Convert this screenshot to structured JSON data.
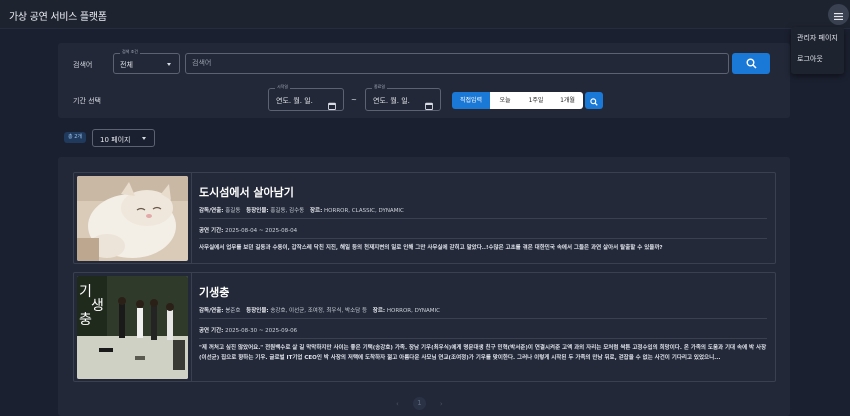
{
  "app": {
    "title": "가상 공연 서비스 플랫폼"
  },
  "menu": {
    "items": [
      "관리자 페이지",
      "로그아웃"
    ]
  },
  "search": {
    "label": "검색어",
    "condition_legend": "검색 조건",
    "condition_value": "전체",
    "placeholder": "검색어"
  },
  "period": {
    "label": "기간 선택",
    "start_legend": "시작일",
    "start_value": "연도. 월. 일.",
    "tilde": "~",
    "end_legend": "종료일",
    "end_value": "연도. 월. 일.",
    "ranges": [
      "직접입력",
      "오늘",
      "1주일",
      "1개월"
    ],
    "active_range": "직접입력"
  },
  "listing": {
    "total_badge": "총 2개",
    "page_size": "10 페이지"
  },
  "performances": [
    {
      "title": "도시섬에서 살아남기",
      "director_label": "감독/연출:",
      "director": "홍길동",
      "cast_label": "등장인물:",
      "cast": "홍길동, 김수동",
      "genre_label": "장르:",
      "genre": "HORROR, CLASSIC, DYNAMIC",
      "period_label": "공연 기간:",
      "period": "2025-08-04 ~ 2025-08-04",
      "description": "사무실에서 업무를 보던 길동과 수동이, 갑작스레 닥친 지진, 해일 등의 천재지변의 일로 인해 그만 사무실에 갇히고 말았다..!수많은 고초를 겪은 대한민국 속에서 그들은 과연 살아서 탈출할 수 있을까?"
    },
    {
      "title": "기생충",
      "director_label": "감독/연출:",
      "director": "봉준호",
      "cast_label": "등장인물:",
      "cast": "송강호, 이선균, 조여정, 최우식, 박소담 등",
      "genre_label": "장르:",
      "genre": "HORROR, DYNAMIC",
      "period_label": "공연 기간:",
      "period": "2025-08-30 ~ 2025-09-06",
      "description": "\"제 꺼처고 싶진 않았어요.\" 전원백수로 살 길 막막하지만 사이는 좋은 기택(송강호) 가족. 장남 기우(최우식)에게 명문대생 친구 민혁(박서준)이 연결시켜준 고액 과외 자리는 모처럼 싹튼 고정수입의 희망이다. 온 가족의 도움과 기대 속에 박 사장(이선균) 집으로 향하는 기우. 글로벌 IT기업 CEO인 박 사장의 저택에 도착하자 젊고 아름다운 사모님 연교(조여정)가 기우를 맞이한다. 그러나 이렇게 시작된 두 가족의 만남 뒤로, 걷잡을 수 없는 사건이 기다리고 있었으니..."
    }
  ],
  "pagination": {
    "current": "1",
    "prev": "‹",
    "next": "›"
  },
  "colors": {
    "accent": "#1a78d6",
    "background": "#1b2030",
    "panel": "#222838"
  },
  "icons": [
    "hamburger-menu-icon",
    "caret-down-icon",
    "search-icon",
    "calendar-icon"
  ]
}
